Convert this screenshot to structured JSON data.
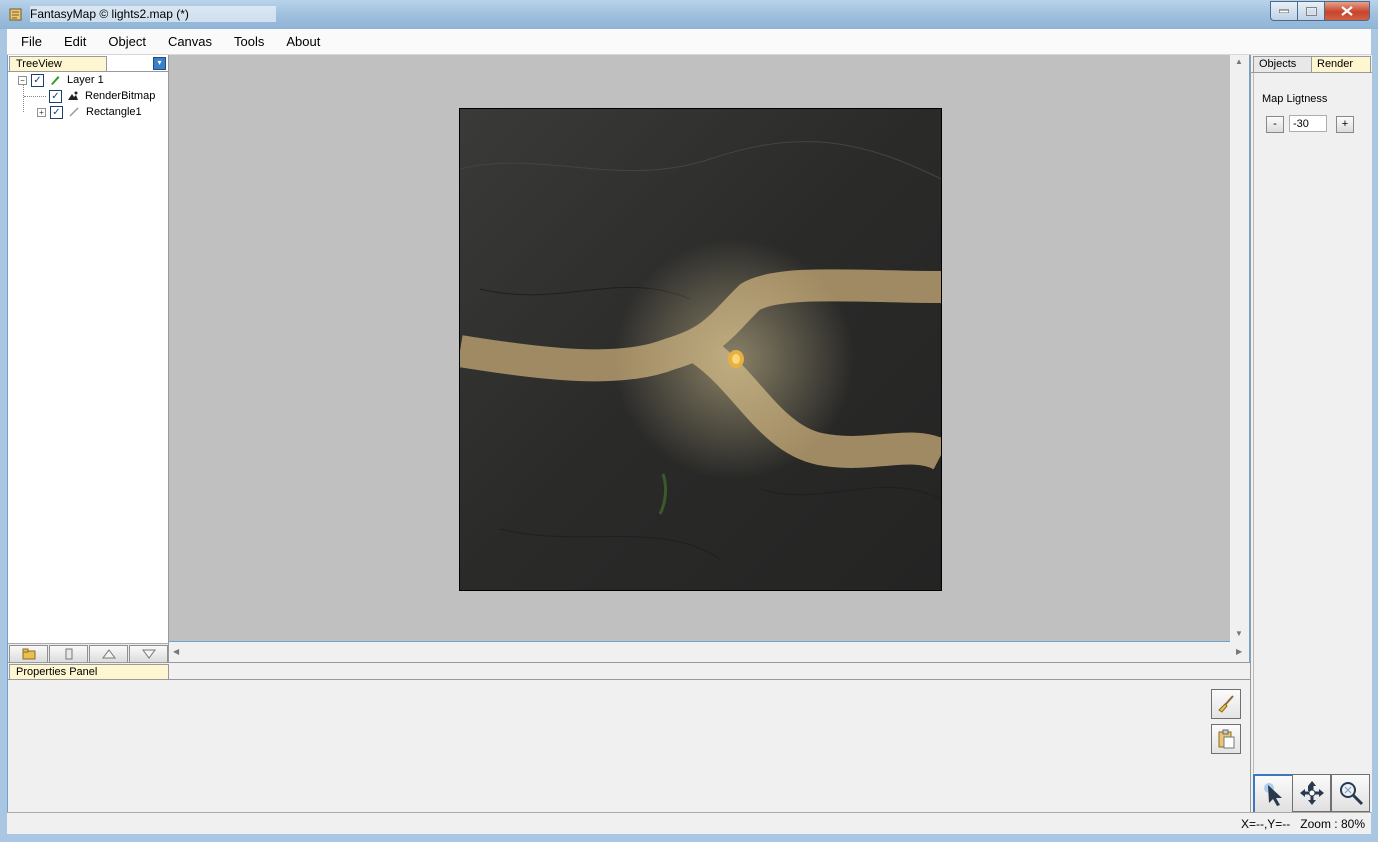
{
  "window": {
    "title": "FantasyMap © lights2.map (*)"
  },
  "menu": {
    "items": [
      "File",
      "Edit",
      "Object",
      "Canvas",
      "Tools",
      "About"
    ]
  },
  "tree": {
    "tab_label": "TreeView",
    "nodes": [
      {
        "label": "Layer 1",
        "checked": "✓",
        "expander": "−"
      },
      {
        "label": "RenderBitmap",
        "checked": "✓"
      },
      {
        "label": "Rectangle1",
        "checked": "✓",
        "expander": "+"
      }
    ]
  },
  "right_panel": {
    "tabs": [
      "Objects",
      "Render"
    ],
    "active_tab": "Render",
    "map_lightness_label": "Map Ligtness",
    "minus_label": "-",
    "plus_label": "+",
    "lightness_value": "-30"
  },
  "properties": {
    "tab_label": "Properties Panel"
  },
  "status": {
    "coords": "X=--,Y=--",
    "zoom": "Zoom : 80%"
  },
  "colors": {
    "tab_highlight": "#fdf6d0",
    "canvas_bg": "#c0c0c0",
    "path_color": "#a08a63"
  }
}
